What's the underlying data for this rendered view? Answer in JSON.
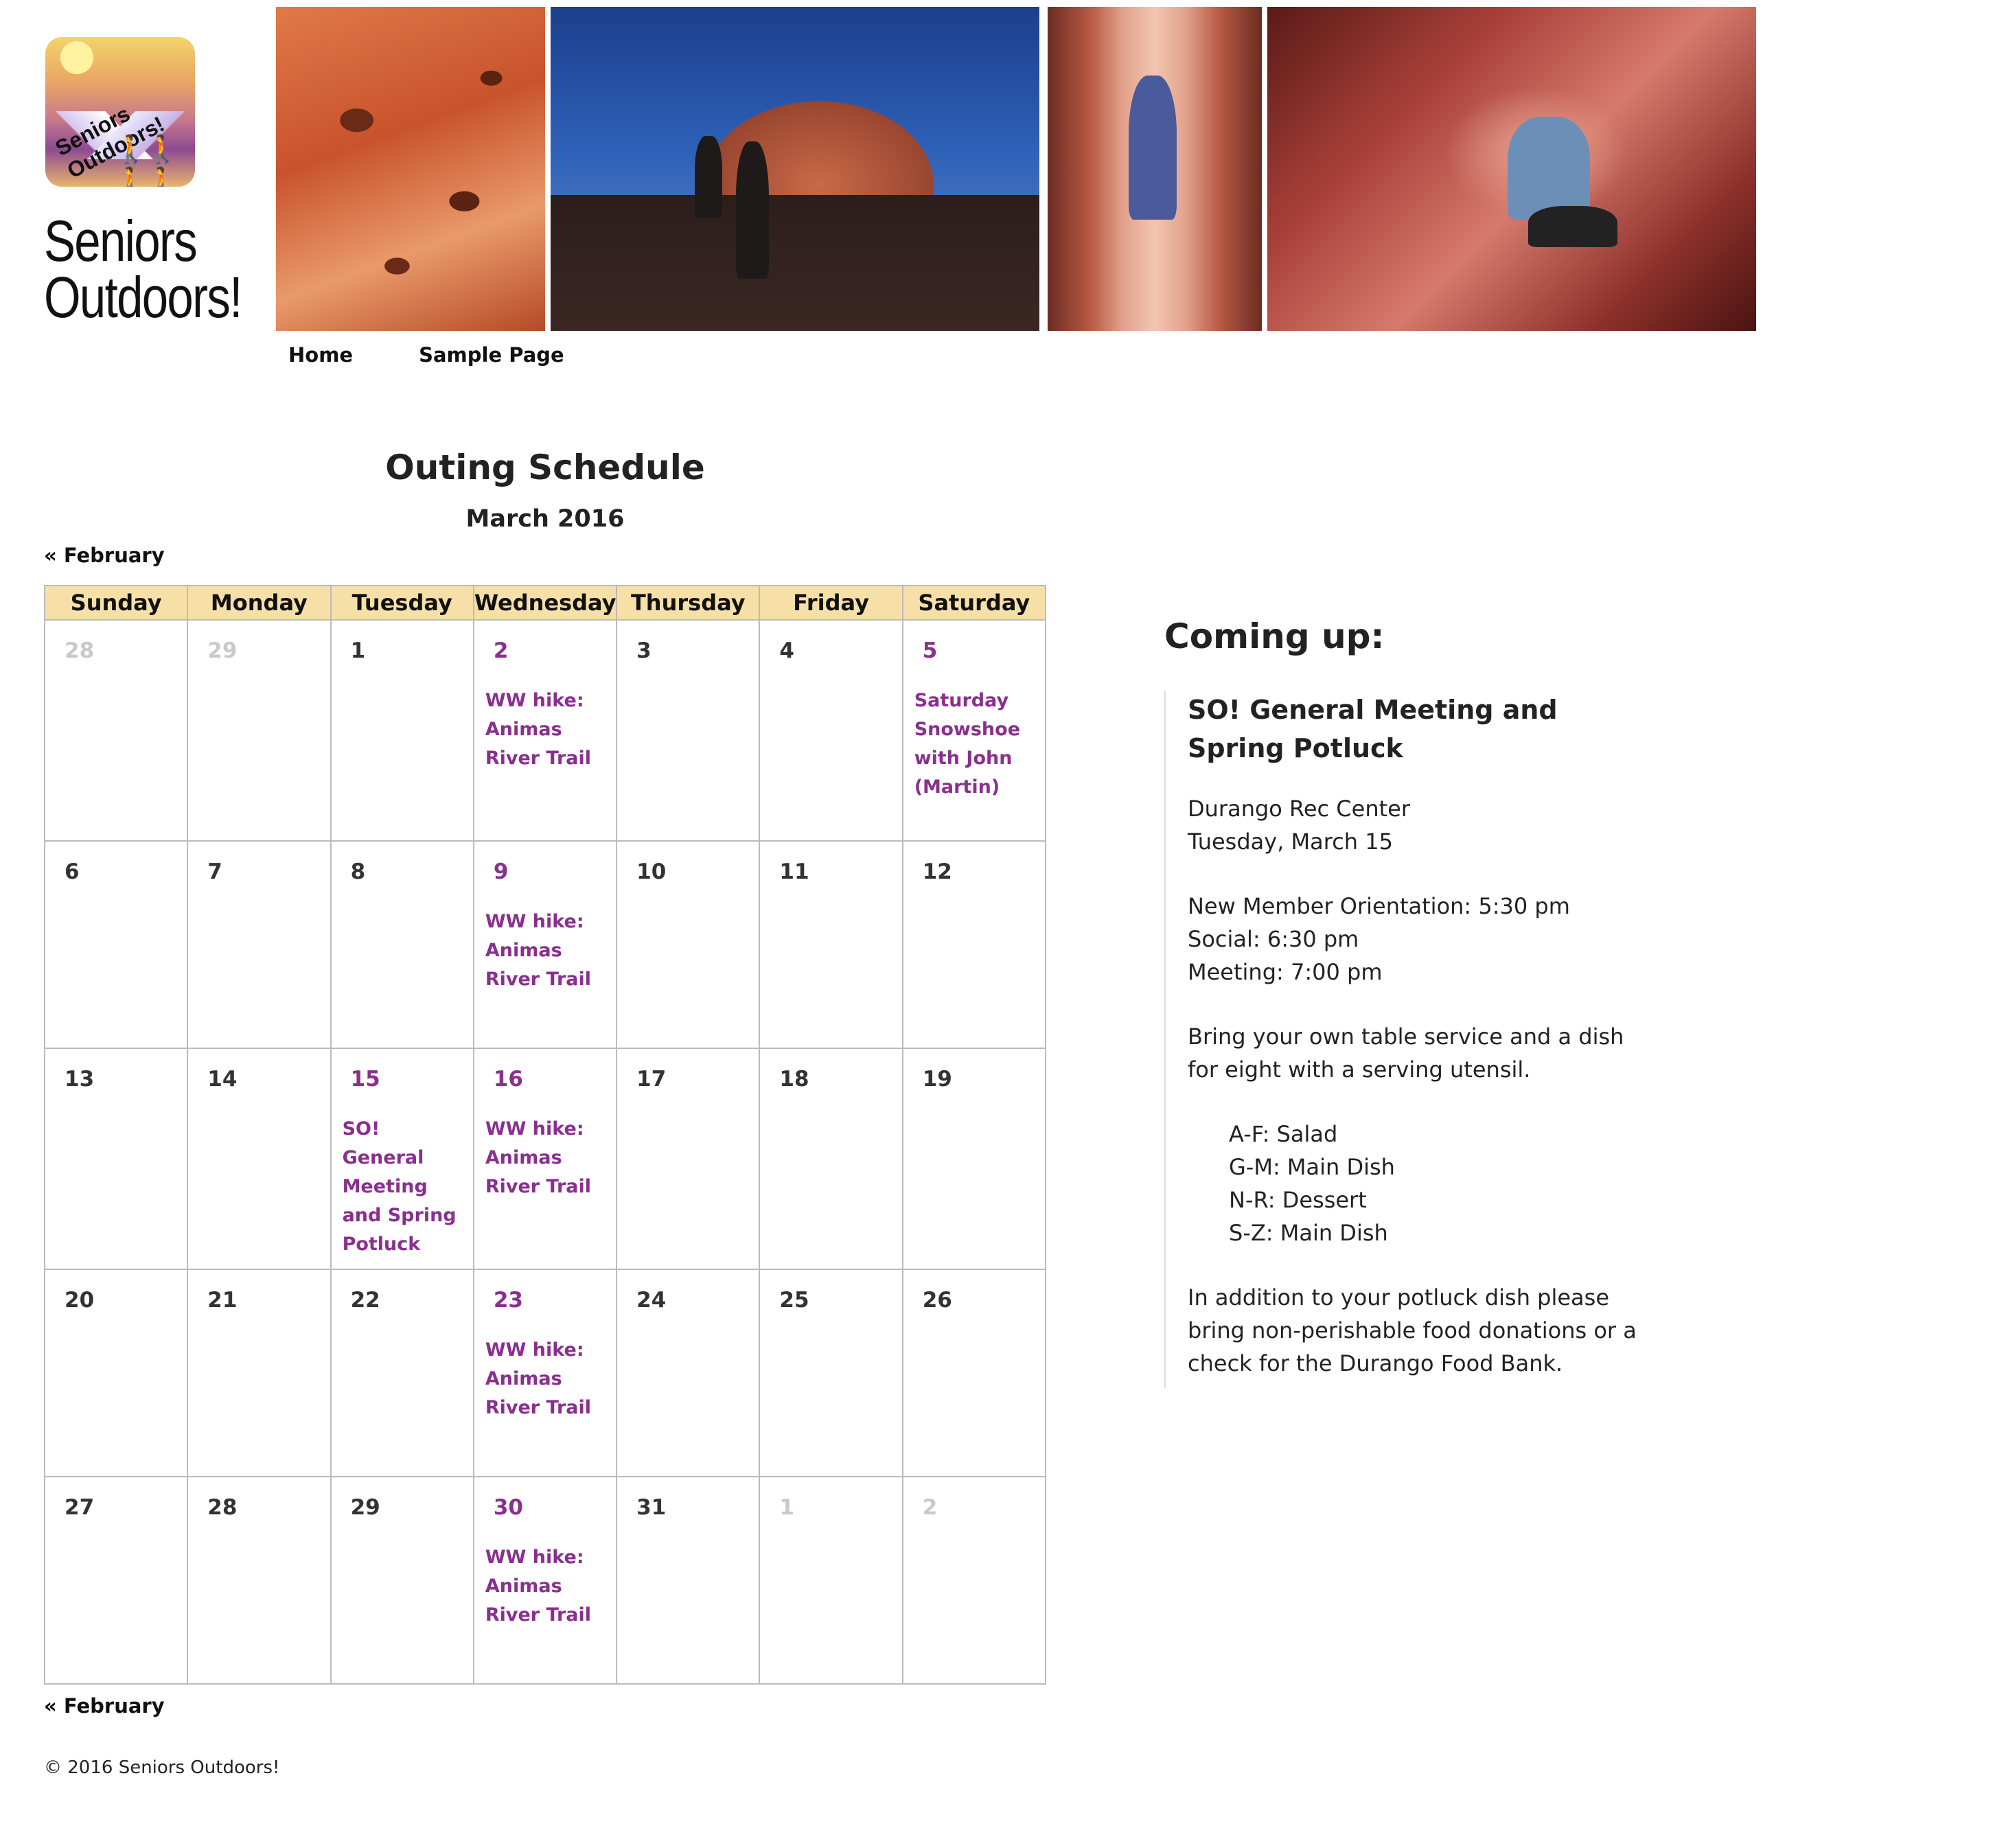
{
  "site": {
    "title": "Seniors Outdoors!",
    "logo_text": "Seniors Outdoors!"
  },
  "nav": [
    {
      "label": "Home"
    },
    {
      "label": "Sample Page"
    }
  ],
  "page": {
    "title": "Outing Schedule"
  },
  "calendar": {
    "month_label": "March 2016",
    "prev_label": "« February",
    "headers": [
      "Sunday",
      "Monday",
      "Tuesday",
      "Wednesday",
      "Thursday",
      "Friday",
      "Saturday"
    ],
    "weeks": [
      [
        {
          "day": "28",
          "other": true
        },
        {
          "day": "29",
          "other": true
        },
        {
          "day": "1"
        },
        {
          "day": "2",
          "event": "WW hike: Animas River Trail"
        },
        {
          "day": "3"
        },
        {
          "day": "4"
        },
        {
          "day": "5",
          "event": "Saturday Snowshoe with John (Martin)"
        }
      ],
      [
        {
          "day": "6"
        },
        {
          "day": "7"
        },
        {
          "day": "8"
        },
        {
          "day": "9",
          "event": "WW hike: Animas River Trail"
        },
        {
          "day": "10"
        },
        {
          "day": "11"
        },
        {
          "day": "12"
        }
      ],
      [
        {
          "day": "13"
        },
        {
          "day": "14"
        },
        {
          "day": "15",
          "event": "SO! General Meeting and Spring Potluck"
        },
        {
          "day": "16",
          "event": "WW hike: Animas River Trail"
        },
        {
          "day": "17"
        },
        {
          "day": "18"
        },
        {
          "day": "19"
        }
      ],
      [
        {
          "day": "20"
        },
        {
          "day": "21"
        },
        {
          "day": "22"
        },
        {
          "day": "23",
          "event": "WW hike: Animas River Trail"
        },
        {
          "day": "24"
        },
        {
          "day": "25"
        },
        {
          "day": "26"
        }
      ],
      [
        {
          "day": "27"
        },
        {
          "day": "28"
        },
        {
          "day": "29"
        },
        {
          "day": "30",
          "event": "WW hike: Animas River Trail"
        },
        {
          "day": "31"
        },
        {
          "day": "1",
          "other": true
        },
        {
          "day": "2",
          "other": true
        }
      ]
    ]
  },
  "sidebar": {
    "title": "Coming up:",
    "event_title": "SO! General Meeting and Spring Potluck",
    "location": "Durango Rec Center",
    "date": "Tuesday, March 15",
    "schedule": [
      "New Member Orientation: 5:30 pm",
      "Social: 6:30 pm",
      "Meeting: 7:00 pm"
    ],
    "bring": "Bring your own table service and a dish for eight with a serving utensil.",
    "assignments": [
      "A-F: Salad",
      "G-M: Main Dish",
      "N-R: Dessert",
      "S-Z: Main Dish"
    ],
    "extra": "In addition to your potluck dish please bring non-perishable food donations or a check for the Durango Food Bank."
  },
  "footer": {
    "copyright": "© 2016 Seniors Outdoors!"
  },
  "colors": {
    "event": "#8a2f8f",
    "header_bg": "#f6e0a8",
    "grid": "#bbbbbb"
  },
  "icons": {
    "logo": "seniors-outdoors-logo"
  }
}
